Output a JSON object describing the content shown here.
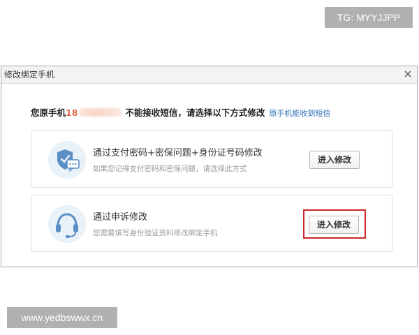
{
  "watermarks": {
    "top": "TG: MYYJJPP",
    "bottom": "www.yedbswwx.cn"
  },
  "dialog": {
    "title": "修改绑定手机",
    "close_label": "×"
  },
  "notice": {
    "prefix": "您原手机",
    "phone_partial": "18",
    "suffix": "不能接收短信，请选择以下方式修改",
    "link": "原手机能收到短信"
  },
  "options": [
    {
      "title": "通过支付密码+密保问题+身份证号码修改",
      "desc": "如果您记得支付密码和密保问题，请选择此方式",
      "button": "进入修改",
      "icon": "shield-chat-icon"
    },
    {
      "title": "通过申诉修改",
      "desc": "您需要填写身份验证资料修改绑定手机",
      "button": "进入修改",
      "icon": "headset-icon"
    }
  ],
  "colors": {
    "phone": "#e26a4a",
    "link": "#2b6cb4",
    "highlight": "#c9272a",
    "icon_circle": "#e9f1f9",
    "icon_blue": "#5b8fc6"
  }
}
